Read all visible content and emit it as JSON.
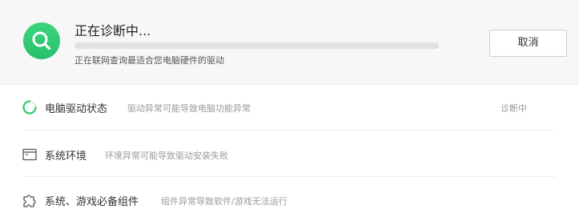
{
  "scan": {
    "title": "正在诊断中...",
    "subtitle": "正在联网查询最适合您电脑硬件的驱动",
    "progress": 0.0,
    "accent_color": "#2ecc71",
    "icon": "search-icon"
  },
  "actions": {
    "cancel_label": "取消"
  },
  "items": [
    {
      "icon": "spinner-icon",
      "title": "电脑驱动状态",
      "description": "驱动异常可能导致电脑功能异常",
      "status": "诊断中"
    },
    {
      "icon": "window-icon",
      "title": "系统环境",
      "description": "环境异常可能导致驱动安装失败",
      "status": ""
    },
    {
      "icon": "puzzle-icon",
      "title": "系统、游戏必备组件",
      "description": "组件异常导致软件/游戏无法运行",
      "status": ""
    }
  ]
}
